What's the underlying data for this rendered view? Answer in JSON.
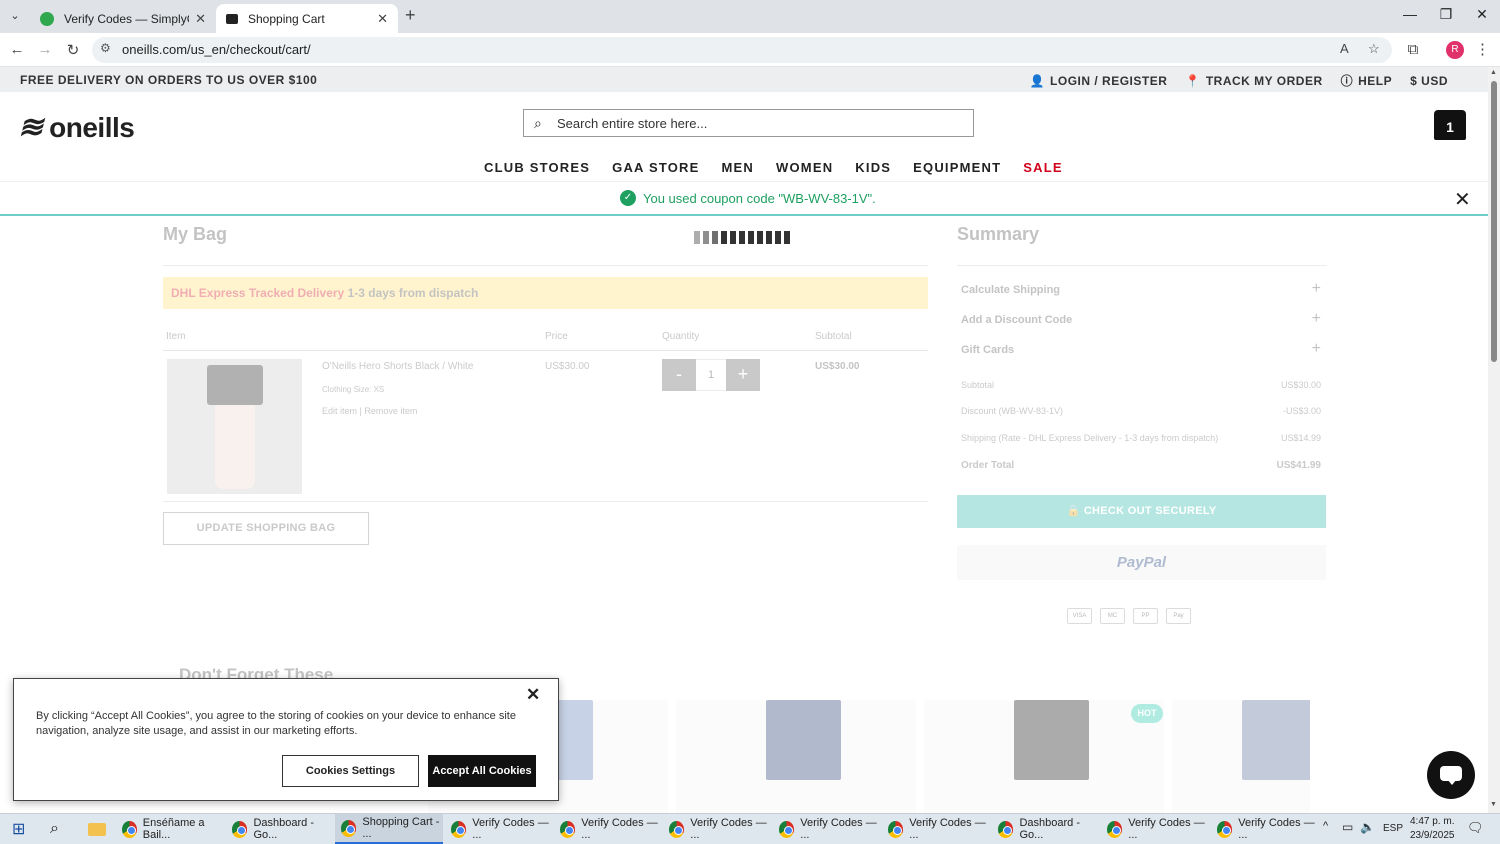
{
  "browser": {
    "tabs": [
      {
        "title": "Verify Codes — SimplyCodes",
        "active": false
      },
      {
        "title": "Shopping Cart",
        "active": true
      }
    ],
    "url": "oneills.com/us_en/checkout/cart/"
  },
  "topbar": {
    "promo": "FREE DELIVERY ON ORDERS TO US OVER $100",
    "login": "LOGIN / REGISTER",
    "track": "TRACK MY ORDER",
    "help": "HELP",
    "currency": "$ USD"
  },
  "header": {
    "logo": "oneills",
    "search_placeholder": "Search entire store here...",
    "cart_count": "1"
  },
  "nav": {
    "items": [
      "CLUB STORES",
      "GAA STORE",
      "MEN",
      "WOMEN",
      "KIDS",
      "EQUIPMENT",
      "SALE"
    ]
  },
  "notice": {
    "message": "You used coupon code \"WB-WV-83-1V\"."
  },
  "bag": {
    "title": "My Bag",
    "delivery_banner": {
      "part1": "DHL Express Tracked Delivery",
      "part2": "1-3 days from dispatch"
    },
    "columns": [
      "Item",
      "Price",
      "Quantity",
      "Subtotal"
    ],
    "item": {
      "name": "O'Neills Hero Shorts Black / White",
      "size": "Clothing Size: XS",
      "edit": "Edit item",
      "remove": "Remove item",
      "price": "US$30.00",
      "qty": "1",
      "subtotal": "US$30.00"
    },
    "update_button": "UPDATE SHOPPING BAG"
  },
  "summary": {
    "title": "Summary",
    "accordions": [
      "Calculate Shipping",
      "Add a Discount Code",
      "Gift Cards"
    ],
    "rows": [
      {
        "label": "Subtotal",
        "value": "US$30.00"
      },
      {
        "label": "Discount (WB-WV-83-1V)",
        "value": "-US$3.00"
      },
      {
        "label": "Shipping (Rate - DHL Express Delivery - 1-3 days from dispatch)",
        "value": "US$14.99"
      }
    ],
    "total": {
      "label": "Order Total",
      "value": "US$41.99"
    },
    "checkout_button": "CHECK OUT SECURELY",
    "paypal": "PayPal",
    "payment_methods": [
      "VISA",
      "MC",
      "PP",
      "Pay"
    ]
  },
  "recommend": {
    "title": "Don't Forget These",
    "hot_badge": "HOT"
  },
  "cookie": {
    "text": "By clicking “Accept All Cookies”, you agree to the storing of cookies on your device to enhance site navigation, analyze site usage, and assist in our marketing efforts.",
    "settings_button": "Cookies Settings",
    "accept_button": "Accept All Cookies"
  },
  "taskbar": {
    "items": [
      "Enséñame a Bail...",
      "Dashboard - Go...",
      "Shopping Cart - ...",
      "Verify Codes — ...",
      "Verify Codes — ...",
      "Verify Codes — ...",
      "Verify Codes — ...",
      "Verify Codes — ...",
      "Dashboard - Go...",
      "Verify Codes — ...",
      "Verify Codes — ..."
    ],
    "lang": "ESP",
    "time": "4:47 p. m.",
    "date": "23/9/2025"
  },
  "colors": {
    "accent_teal": "#2bb8a8",
    "sale_red": "#d0021b",
    "success_green": "#1ea060"
  }
}
